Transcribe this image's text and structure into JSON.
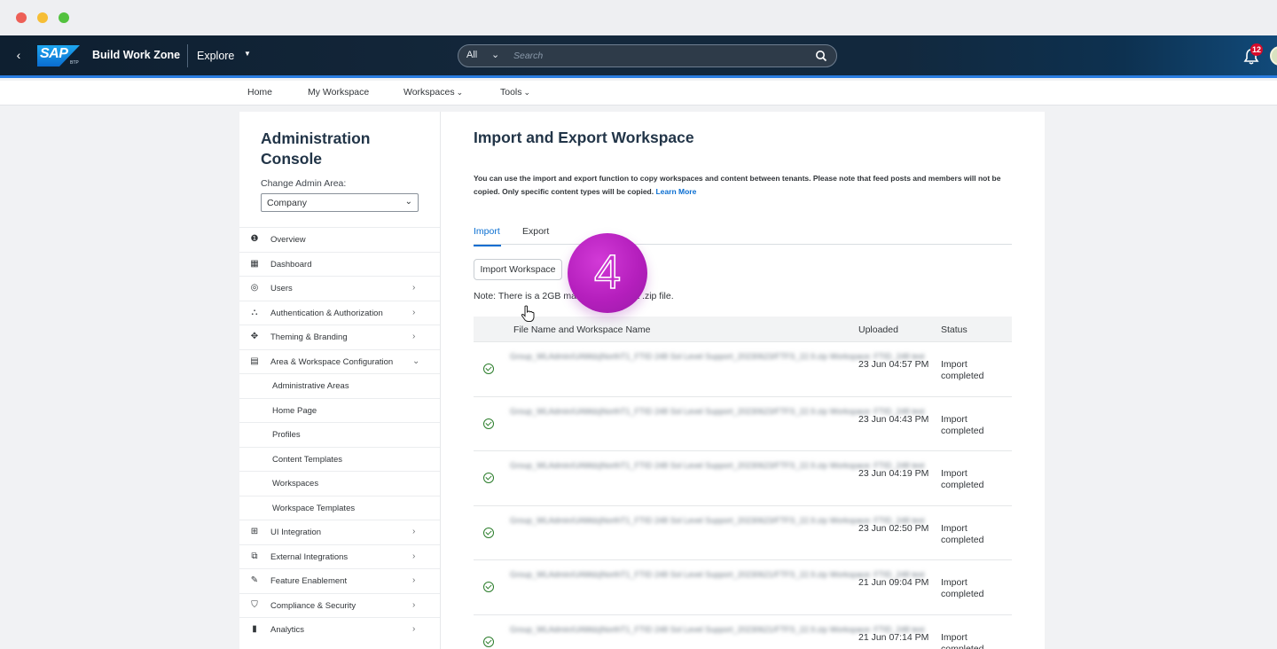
{
  "shell": {
    "back_icon": "chevron-left-icon",
    "logo_text": "SAP",
    "logo_sub": "BTP",
    "product_name": "Build Work Zone",
    "explore_label": "Explore",
    "search": {
      "scope": "All",
      "placeholder": "Search"
    },
    "notifications_count": "12"
  },
  "topnav": {
    "items": [
      {
        "label": "Home",
        "has_caret": false
      },
      {
        "label": "My Workspace",
        "has_caret": false
      },
      {
        "label": "Workspaces",
        "has_caret": true
      },
      {
        "label": "Tools",
        "has_caret": true
      }
    ]
  },
  "sidebar": {
    "title": "Administration Console",
    "change_area_label": "Change Admin Area:",
    "area_value": "Company",
    "items": [
      {
        "label": "Overview",
        "icon": "info-icon",
        "arrow": ""
      },
      {
        "label": "Dashboard",
        "icon": "dashboard-icon",
        "arrow": ""
      },
      {
        "label": "Users",
        "icon": "user-circle-icon",
        "arrow": "›"
      },
      {
        "label": "Authentication & Authorization",
        "icon": "hierarchy-icon",
        "arrow": "›"
      },
      {
        "label": "Theming & Branding",
        "icon": "palette-icon",
        "arrow": "›"
      },
      {
        "label": "Area & Workspace Configuration",
        "icon": "workspace-config-icon",
        "arrow": "⌄"
      },
      {
        "label": "Administrative Areas",
        "icon": "",
        "arrow": "",
        "sub": true
      },
      {
        "label": "Home Page",
        "icon": "",
        "arrow": "",
        "sub": true
      },
      {
        "label": "Profiles",
        "icon": "",
        "arrow": "",
        "sub": true
      },
      {
        "label": "Content Templates",
        "icon": "",
        "arrow": "",
        "sub": true
      },
      {
        "label": "Workspaces",
        "icon": "",
        "arrow": "",
        "sub": true
      },
      {
        "label": "Workspace Templates",
        "icon": "",
        "arrow": "",
        "sub": true
      },
      {
        "label": "UI Integration",
        "icon": "ui-integration-icon",
        "arrow": "›"
      },
      {
        "label": "External Integrations",
        "icon": "external-link-icon",
        "arrow": "›"
      },
      {
        "label": "Feature Enablement",
        "icon": "feature-icon",
        "arrow": "›"
      },
      {
        "label": "Compliance & Security",
        "icon": "shield-icon",
        "arrow": "›"
      },
      {
        "label": "Analytics",
        "icon": "analytics-icon",
        "arrow": "›"
      }
    ]
  },
  "main": {
    "title": "Import and Export Workspace",
    "description": "You can use the import and export function to copy workspaces and content between tenants. Please note that feed posts and members will not be copied. Only specific content types will be copied.",
    "learn_more": "Learn More",
    "tabs": [
      {
        "label": "Import"
      },
      {
        "label": "Export"
      }
    ],
    "import_button": "Import Workspace",
    "note": "Note: There is a 2GB ma… you import a .zip file.",
    "step_number": "4",
    "table": {
      "headers": {
        "file": "File Name and Workspace Name",
        "uploaded": "Uploaded",
        "status": "Status"
      },
      "rows": [
        {
          "file": "Group_WLAdmin/UAMdzjNorthT1_FTID 248 Sol Level Support_20230623/FTFS_22.9.zip Workspace: FTID_248 test",
          "uploaded": "23 Jun 04:57 PM",
          "status": "Import completed"
        },
        {
          "file": "Group_WLAdmin/UAMdzjNorthT1_FTID 248 Sol Level Support_20230623/FTFS_22.9.zip Workspace: FTID_248 test",
          "uploaded": "23 Jun 04:43 PM",
          "status": "Import completed"
        },
        {
          "file": "Group_WLAdmin/UAMdzjNorthT1_FTID 248 Sol Level Support_20230623/FTFS_22.9.zip Workspace: FTID_248 test",
          "uploaded": "23 Jun 04:19 PM",
          "status": "Import completed"
        },
        {
          "file": "Group_WLAdmin/UAMdzjNorthT1_FTID 248 Sol Level Support_20230623/FTFS_22.9.zip Workspace: FTID_248 test",
          "uploaded": "23 Jun 02:50 PM",
          "status": "Import completed"
        },
        {
          "file": "Group_WLAdmin/UAMdzjNorthT1_FTID 248 Sol Level Support_20230621/FTFS_22.9.zip Workspace: FTID_248 test",
          "uploaded": "21 Jun 09:04 PM",
          "status": "Import completed"
        },
        {
          "file": "Group_WLAdmin/UAMdzjNorthT1_FTID 248 Sol Level Support_20230621/FTFS_22.9.zip Workspace: FTID_248 test",
          "uploaded": "21 Jun 07:14 PM",
          "status": "Import completed"
        }
      ]
    }
  }
}
